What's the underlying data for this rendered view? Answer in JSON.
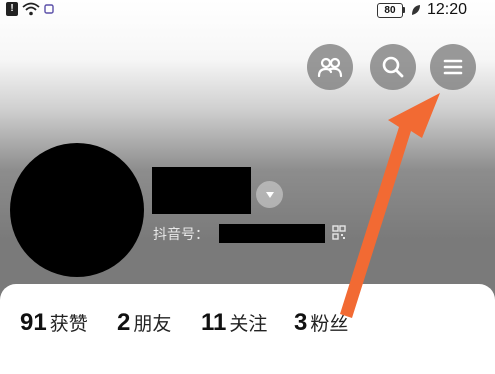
{
  "status_bar": {
    "alert_icon": "alert-icon",
    "battery_level": "80",
    "time": "12:20"
  },
  "top_actions": {
    "friends_icon": "friends-icon",
    "search_icon": "search-icon",
    "menu_icon": "menu-icon"
  },
  "profile": {
    "douyin_id_label": "抖音号：",
    "qr_icon": "qr-code-icon"
  },
  "stats": [
    {
      "count": "91",
      "label": "获赞"
    },
    {
      "count": "2",
      "label": "朋友"
    },
    {
      "count": "11",
      "label": "关注"
    },
    {
      "count": "3",
      "label": "粉丝"
    }
  ],
  "annotation": {
    "arrow_color": "#f26a33"
  }
}
